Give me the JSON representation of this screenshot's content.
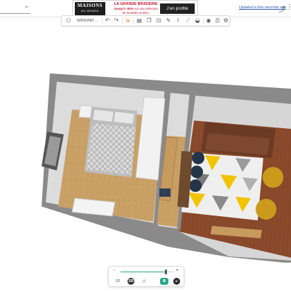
{
  "topbar": {
    "project_name": "",
    "updated_label": "Updated a few seconds ago",
    "share_icon": "share-icon",
    "more_icon": "more-vertical-icon"
  },
  "ad": {
    "brand_line1": "MAISONS",
    "brand_line2": "DU MONDE",
    "headline": "LA GRANDE BRADERIE",
    "offer_bold": "Jusqu'à -50%",
    "offer_rest": " sur une sélection",
    "offer_line2": "de meubles et déco",
    "button_label": "J'en profite"
  },
  "toolbar": {
    "level_label": "GROUND ...",
    "items": [
      "level-icon",
      "undo-icon",
      "redo-icon",
      "measure-icon",
      "document-icon",
      "copy-icon",
      "lock-icon",
      "pencil-icon",
      "brush-icon",
      "eyedropper-icon",
      "paint-icon",
      "eye-icon",
      "print-icon",
      "settings-icon"
    ]
  },
  "view_controls": {
    "zoom_minus": "-",
    "zoom_plus": "+",
    "zoom_level": 0.86,
    "btn_2d": "2D",
    "btn_3d": "3D",
    "btn_walk": "walk-icon",
    "btn_camera": "camera-icon",
    "btn_video": "video-icon"
  },
  "colors": {
    "accent": "#2aa58a",
    "ad_red": "#c8102e",
    "wall": "#8d8d8d",
    "floor_wood": "#c9a066",
    "rug_yellow": "#f2c400"
  }
}
